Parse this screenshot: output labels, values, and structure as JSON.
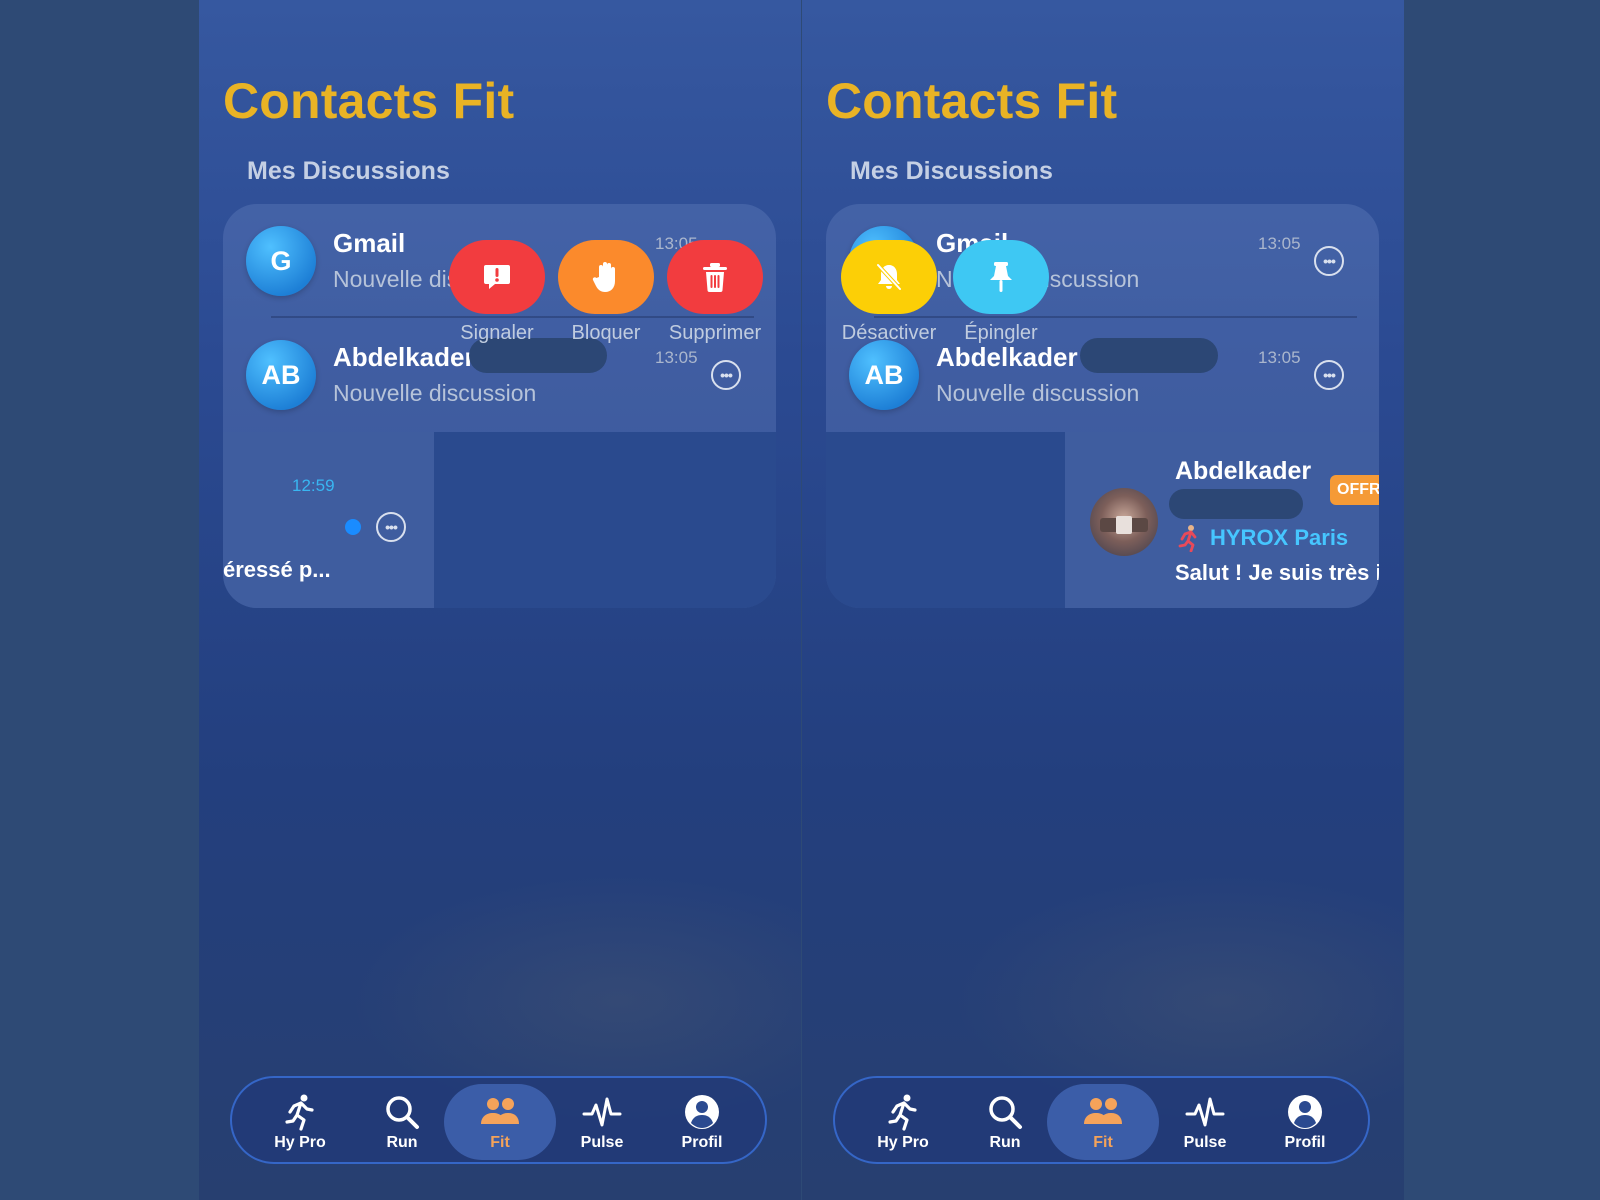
{
  "app": {
    "title": "Contacts Fit",
    "section": "Mes Discussions"
  },
  "colors": {
    "title": "#e9b325",
    "background": "#2e4a75",
    "signaler": "#f23c3f",
    "bloquer": "#fb8a2c",
    "supprimer": "#f23c3f",
    "desactiver": "#fccf06",
    "epingler": "#3ec8f3",
    "nav_active": "#f5a35a",
    "unread": "#1a8cff",
    "offer_badge": "#f59a36",
    "tag": "#46c6ff"
  },
  "conversations": [
    {
      "avatar": "G",
      "name": "Gmail",
      "subtitle": "Nouvelle discussion",
      "time": "13:05",
      "icon": "more-icon"
    },
    {
      "avatar": "AB",
      "name": "Abdelkader",
      "subtitle": "Nouvelle discussion",
      "time": "13:05",
      "icon": "more-icon"
    }
  ],
  "swiped_left": {
    "time": "12:59",
    "preview": "éressé p..."
  },
  "swiped_right": {
    "name": "Abdelkader",
    "badge": "OFFR",
    "tag": "HYROX Paris",
    "preview": "Salut ! Je suis très i"
  },
  "actions_trailing": [
    {
      "label": "Signaler",
      "icon": "report-icon"
    },
    {
      "label": "Bloquer",
      "icon": "hand-icon"
    },
    {
      "label": "Supprimer",
      "icon": "trash-icon"
    }
  ],
  "actions_leading": [
    {
      "label": "Désactiver",
      "icon": "bell-slash-icon"
    },
    {
      "label": "Épingler",
      "icon": "pin-icon"
    }
  ],
  "nav": [
    {
      "label": "Hy Pro",
      "icon": "runner-icon"
    },
    {
      "label": "Run",
      "icon": "search-icon"
    },
    {
      "label": "Fit",
      "icon": "people-icon",
      "active": true
    },
    {
      "label": "Pulse",
      "icon": "pulse-icon"
    },
    {
      "label": "Profil",
      "icon": "profile-icon"
    }
  ]
}
